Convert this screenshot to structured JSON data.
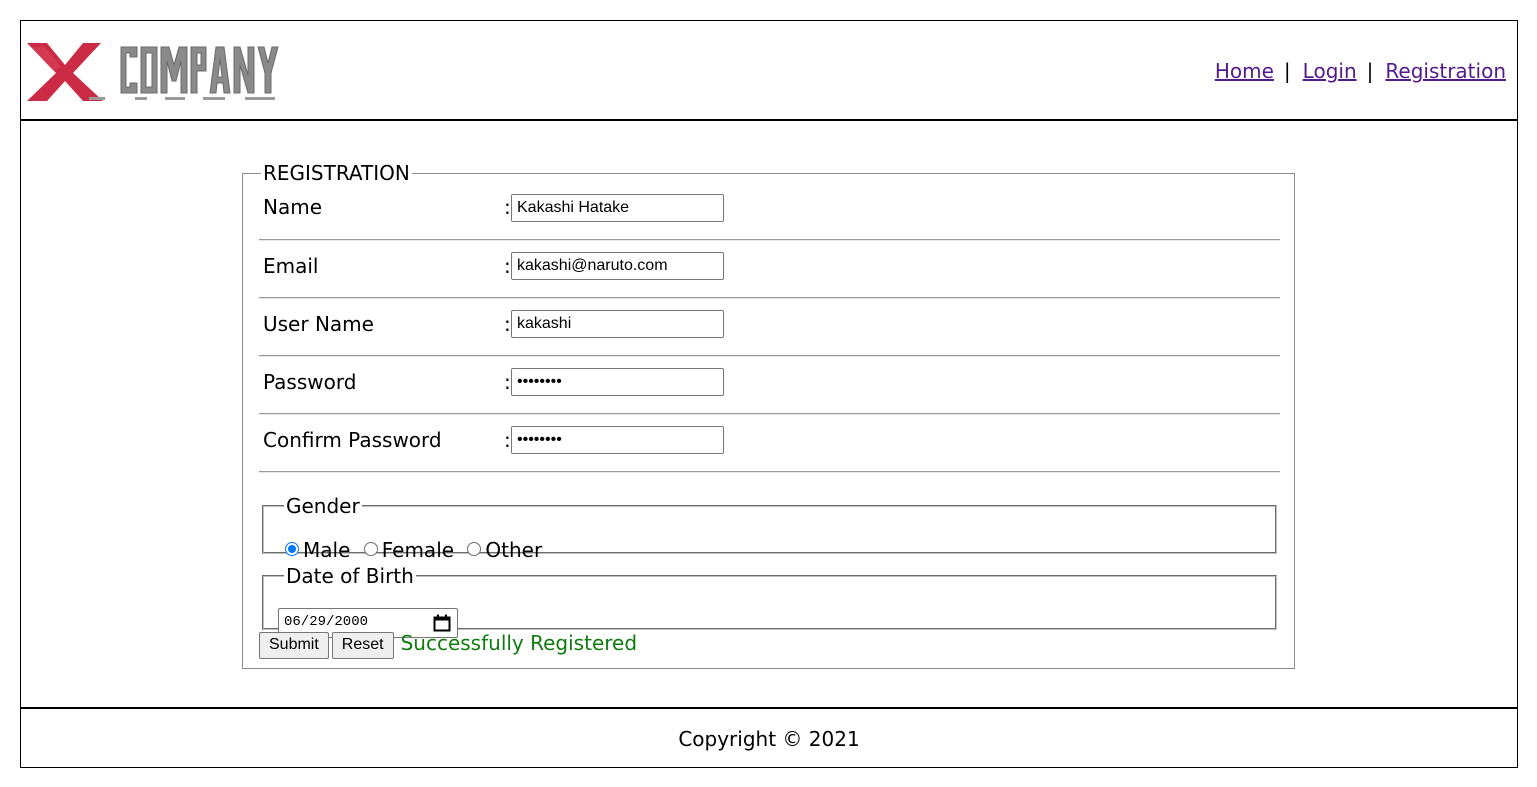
{
  "header": {
    "logo_text": "XCOMPANY",
    "nav": [
      {
        "label": "Home"
      },
      {
        "label": "Login"
      },
      {
        "label": "Registration"
      }
    ],
    "nav_separator": "|"
  },
  "form": {
    "legend": "REGISTRATION",
    "colon": ":",
    "fields": [
      {
        "label": "Name",
        "value": "Kakashi Hatake"
      },
      {
        "label": "Email",
        "value": "kakashi@naruto.com"
      },
      {
        "label": "User Name",
        "value": "kakashi"
      },
      {
        "label": "Password",
        "value": "••••••••"
      },
      {
        "label": "Confirm Password",
        "value": "••••••••"
      }
    ],
    "gender": {
      "legend": "Gender",
      "options": [
        {
          "label": "Male",
          "checked": true
        },
        {
          "label": "Female",
          "checked": false
        },
        {
          "label": "Other",
          "checked": false
        }
      ]
    },
    "dob": {
      "legend": "Date of Birth",
      "value": "06/29/2000"
    },
    "submit_label": "Submit",
    "reset_label": "Reset",
    "status_message": "Successfully Registered"
  },
  "footer": {
    "text": "Copyright © 2021"
  },
  "colors": {
    "link": "#551a8b",
    "success": "#0f7b0f",
    "logo_red": "#c8203a",
    "radio_accent": "#0075ff"
  }
}
